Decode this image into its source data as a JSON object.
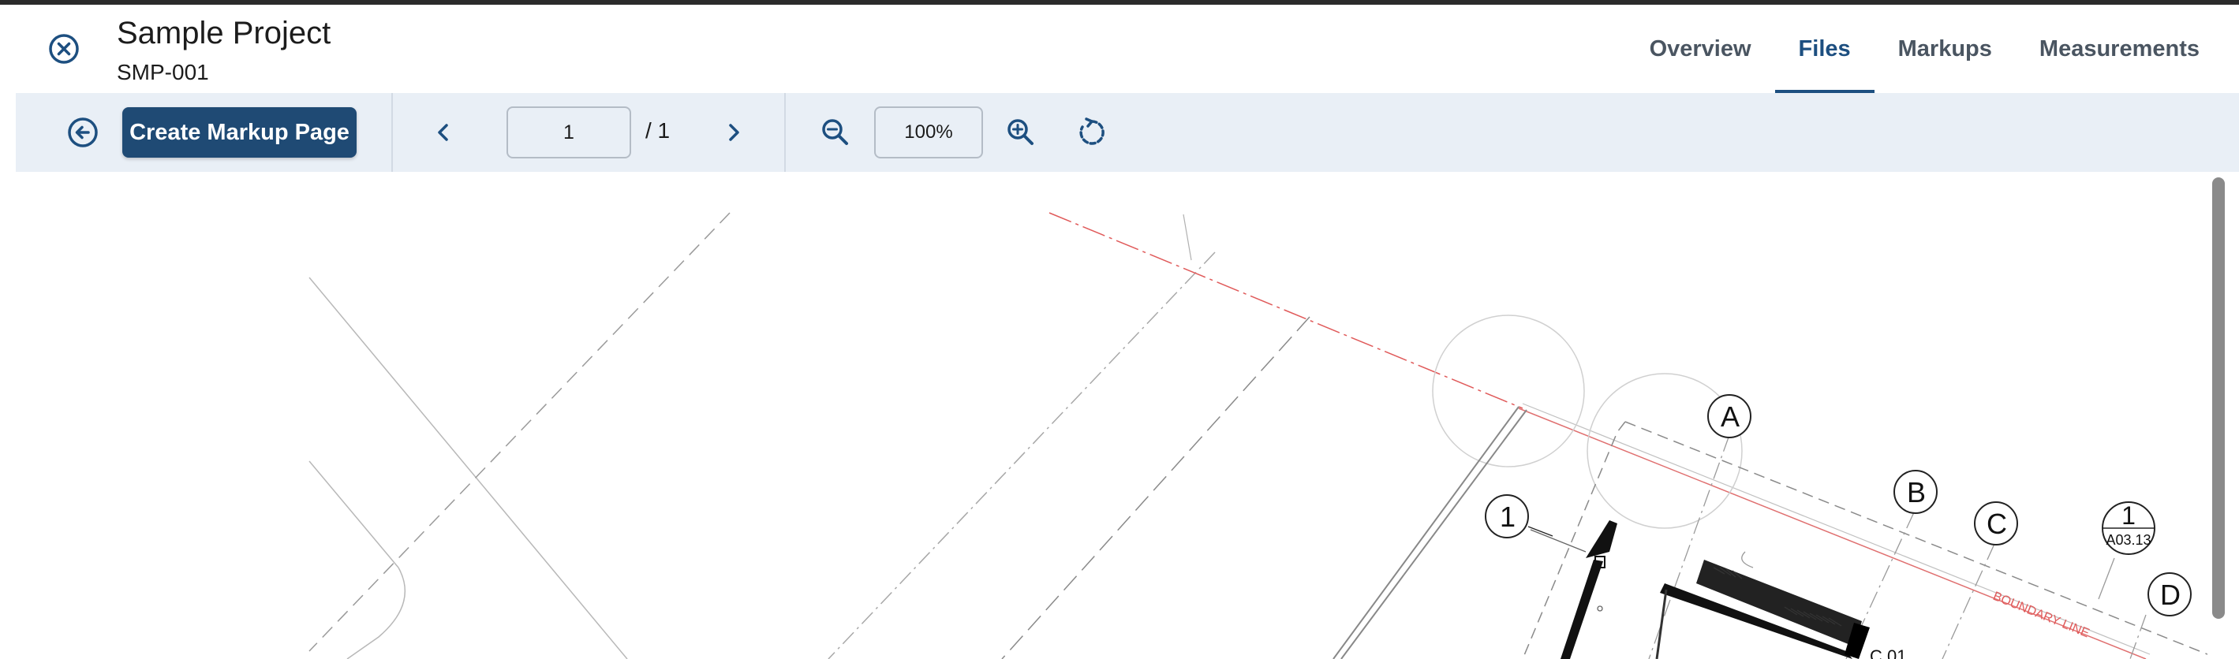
{
  "header": {
    "project_title": "Sample Project",
    "project_code": "SMP-001"
  },
  "tabs": [
    {
      "label": "Overview",
      "active": false
    },
    {
      "label": "Files",
      "active": true
    },
    {
      "label": "Markups",
      "active": false
    },
    {
      "label": "Measurements",
      "active": false
    }
  ],
  "toolbar": {
    "create_label": "Create Markup Page",
    "page_value": "1",
    "page_total": "/ 1",
    "zoom_value": "100%"
  },
  "drawing": {
    "grid_labels": [
      "A",
      "B",
      "C",
      "D",
      "1"
    ],
    "section_marker_top": "1",
    "section_marker_bottom": "A03.13",
    "boundary_label": "BOUNDARY LINE",
    "room_label": "C.01"
  },
  "colors": {
    "accent": "#1d4f80",
    "button": "#1f4a74",
    "toolbar_bg": "#e9eff6",
    "boundary": "#e05a5a"
  }
}
